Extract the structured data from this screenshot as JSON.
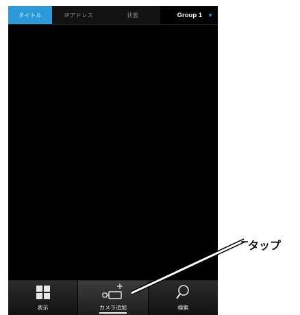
{
  "header": {
    "tabs": [
      {
        "label": "タイトル",
        "active": true
      },
      {
        "label": "IPアドレス",
        "active": false
      },
      {
        "label": "状態",
        "active": false
      }
    ],
    "group_select": {
      "value": "Group 1",
      "icon": "triangle-down-icon"
    }
  },
  "toolbar": {
    "items": [
      {
        "label": "表示",
        "icon": "grid-icon"
      },
      {
        "label": "カメラ追加",
        "icon": "add-camera-icon",
        "selected": true
      },
      {
        "label": "検索",
        "icon": "magnifier-icon"
      }
    ]
  },
  "callout": {
    "text": "タップ"
  },
  "colors": {
    "accent": "#2c9ad8",
    "background": "#000000"
  }
}
